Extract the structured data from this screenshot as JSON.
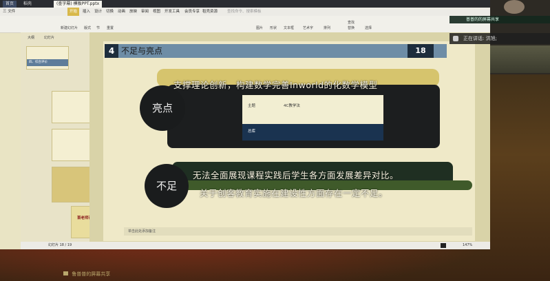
{
  "window": {
    "tabs": [
      "首页",
      "稻壳",
      "(查字幕) 模板PPT.pptx"
    ],
    "menus": [
      "三 文件",
      "开始",
      "插入",
      "设计",
      "切换",
      "动画",
      "放映",
      "审阅",
      "视图",
      "开发工具",
      "会员专享",
      "稻壳资源"
    ],
    "ribbon_search": "查找命令、搜索模板",
    "ribbon_items": [
      "新建幻灯片",
      "版式",
      "节",
      "重置",
      "图片",
      "形状",
      "文本框",
      "艺术字",
      "排列",
      "查找",
      "替换",
      "选择"
    ]
  },
  "left_pane": {
    "tabs": [
      "大纲",
      "幻灯片"
    ],
    "thumb_labels": [
      "四、综合评价",
      "首老师课堂总结"
    ]
  },
  "slide": {
    "section_number": "4",
    "section_title": "不足与亮点",
    "page_badge": "18",
    "highlight_label": "亮点",
    "highlight_text": "支撑理论创新，构建数学完善Inworld的化数学模型",
    "inner_label_a": "主题",
    "inner_label_b": "4C教学法",
    "inner_row_label": "总库",
    "shortcoming_label": "不足",
    "shortcoming_line1": "无法全面展现课程实践后学生各方面发展差异对比。",
    "shortcoming_line2": "关于创客教育实施在建设性方面存在一定不足。"
  },
  "status_bar": {
    "slide_count": "幻灯片 18 / 19",
    "note_placeholder": "单击此处添加备注",
    "zoom": "147%"
  },
  "meeting": {
    "speaker_label": "正在讲话: 洪旭;",
    "share_label": "普普的的屏幕共享",
    "bottom_caption": "鲁普普的屏幕共享"
  }
}
